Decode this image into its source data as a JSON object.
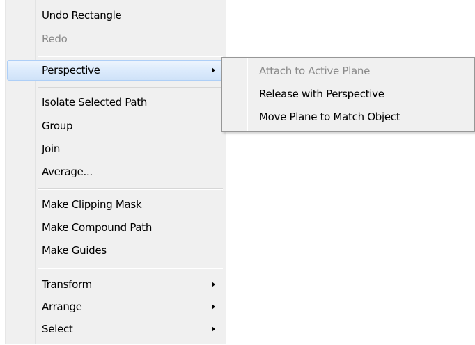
{
  "menu": {
    "undo_rectangle": "Undo Rectangle",
    "redo": "Redo",
    "perspective": "Perspective",
    "isolate_selected_path": "Isolate Selected Path",
    "group": "Group",
    "join": "Join",
    "average": "Average...",
    "make_clipping_mask": "Make Clipping Mask",
    "make_compound_path": "Make Compound Path",
    "make_guides": "Make Guides",
    "transform": "Transform",
    "arrange": "Arrange",
    "select": "Select"
  },
  "submenu": {
    "attach_to_active_plane": "Attach to Active Plane",
    "release_with_perspective": "Release with Perspective",
    "move_plane_to_match_object": "Move Plane to Match Object"
  },
  "icons": {
    "submenu_arrow": "triangle-right-icon"
  },
  "colors": {
    "menu_background": "#f0f0f0",
    "highlight_border": "#aecff7",
    "disabled_text": "#8a8a8a"
  }
}
